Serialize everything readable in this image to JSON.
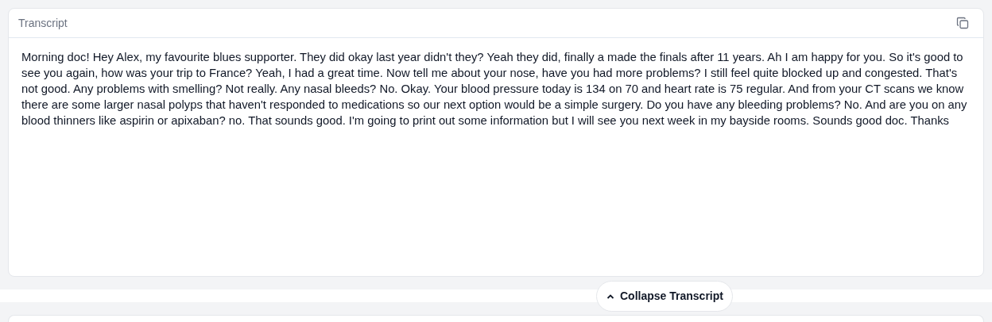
{
  "transcript": {
    "title": "Transcript",
    "text": "Morning doc! Hey Alex, my favourite blues supporter. They did okay last year didn't they? Yeah they did, finally a made the finals after 11 years. Ah I am happy for you. So it's good to see you again, how was your trip to France? Yeah, I had a great time. Now tell me about your nose, have you had more problems? I still feel quite blocked up and congested. That's not good. Any problems with smelling? Not really. Any nasal bleeds? No. Okay. Your blood pressure today is 134 on 70 and heart rate is 75 regular. And from your CT scans we know there are some larger nasal polyps that haven't responded to medications so our next option would be a simple surgery. Do you have any bleeding problems? No. And are you on any blood thinners like aspirin or apixaban? no. That sounds good. I'm going to print out some information but I will see you next week in my bayside rooms. Sounds good doc. Thanks"
  },
  "collapse_button": {
    "label": "Collapse Transcript",
    "expanded": true
  }
}
